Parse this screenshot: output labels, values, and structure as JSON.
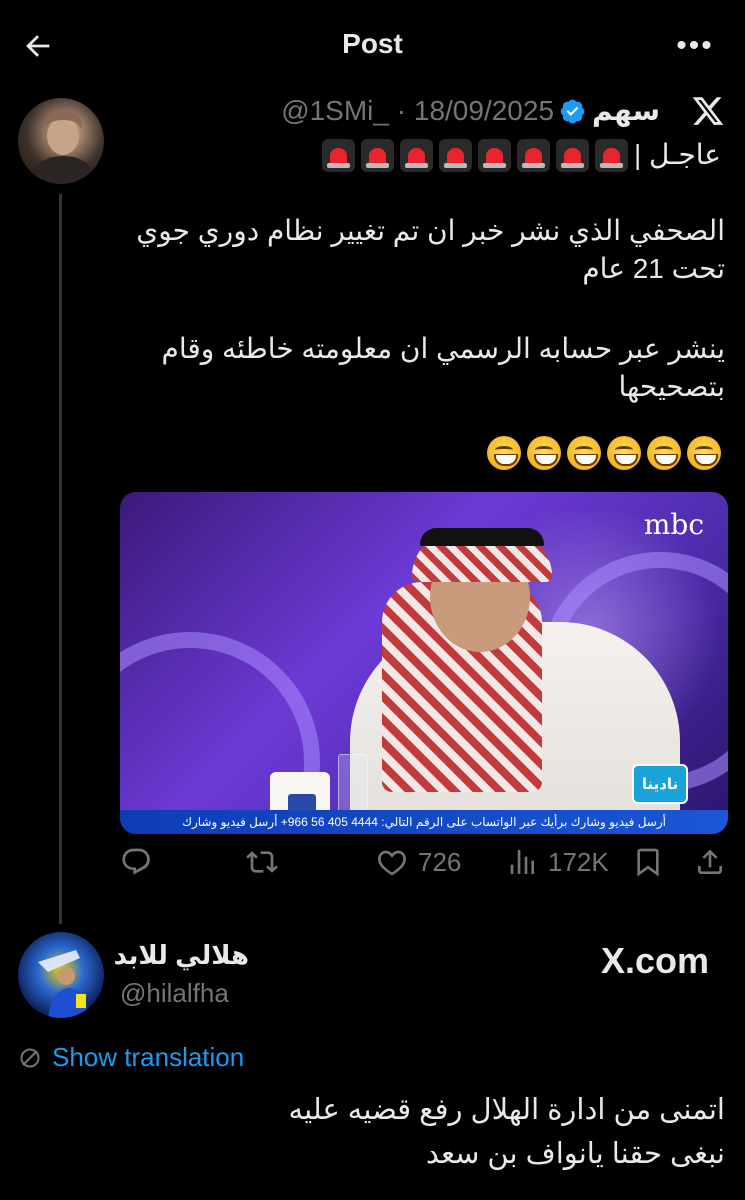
{
  "header": {
    "title": "Post",
    "back_icon": "arrow-left-icon",
    "more_icon": "more-horizontal-icon"
  },
  "quoted_tweet": {
    "author_name": "سهم",
    "handle": "@1SMi_",
    "separator": "·",
    "date": "18/09/2025",
    "verified_color": "#1d9bf0",
    "breaking_label": "عاجـل |",
    "siren_count": 8,
    "paragraph1": "الصحفي الذي نشر خبر ان تم تغيير نظام دوري جوي تحت 21 عام",
    "paragraph2": "ينشر عبر حسابه الرسمي ان معلومته خاطئه وقام بتصحيحها",
    "emoji_count": 6,
    "media": {
      "channel_logo": "mbc",
      "show_logo": "نادينا",
      "ticker": "أرسل فيديو وشارك برأيك عبر الواتساب على الرقم التالي: 4444 405 56 966+   أرسل فيديو وشارك"
    },
    "actions": {
      "reply_icon": "reply-icon",
      "retweet_icon": "retweet-icon",
      "like_count": "726",
      "views_count": "172K",
      "bookmark_icon": "bookmark-icon",
      "share_icon": "share-icon"
    }
  },
  "reply": {
    "author_name": "هلالي للابد",
    "handle": "@hilalfha",
    "watermark": "X.com",
    "show_translation": "Show translation",
    "line1": "اتمنى من ادارة الهلال رفع قضيه عليه",
    "line2": "نبغى حقنا يانواف بن سعد"
  },
  "colors": {
    "background": "#000000",
    "text": "#e7e9ea",
    "muted": "#71767b",
    "accent": "#1d9bf0"
  }
}
